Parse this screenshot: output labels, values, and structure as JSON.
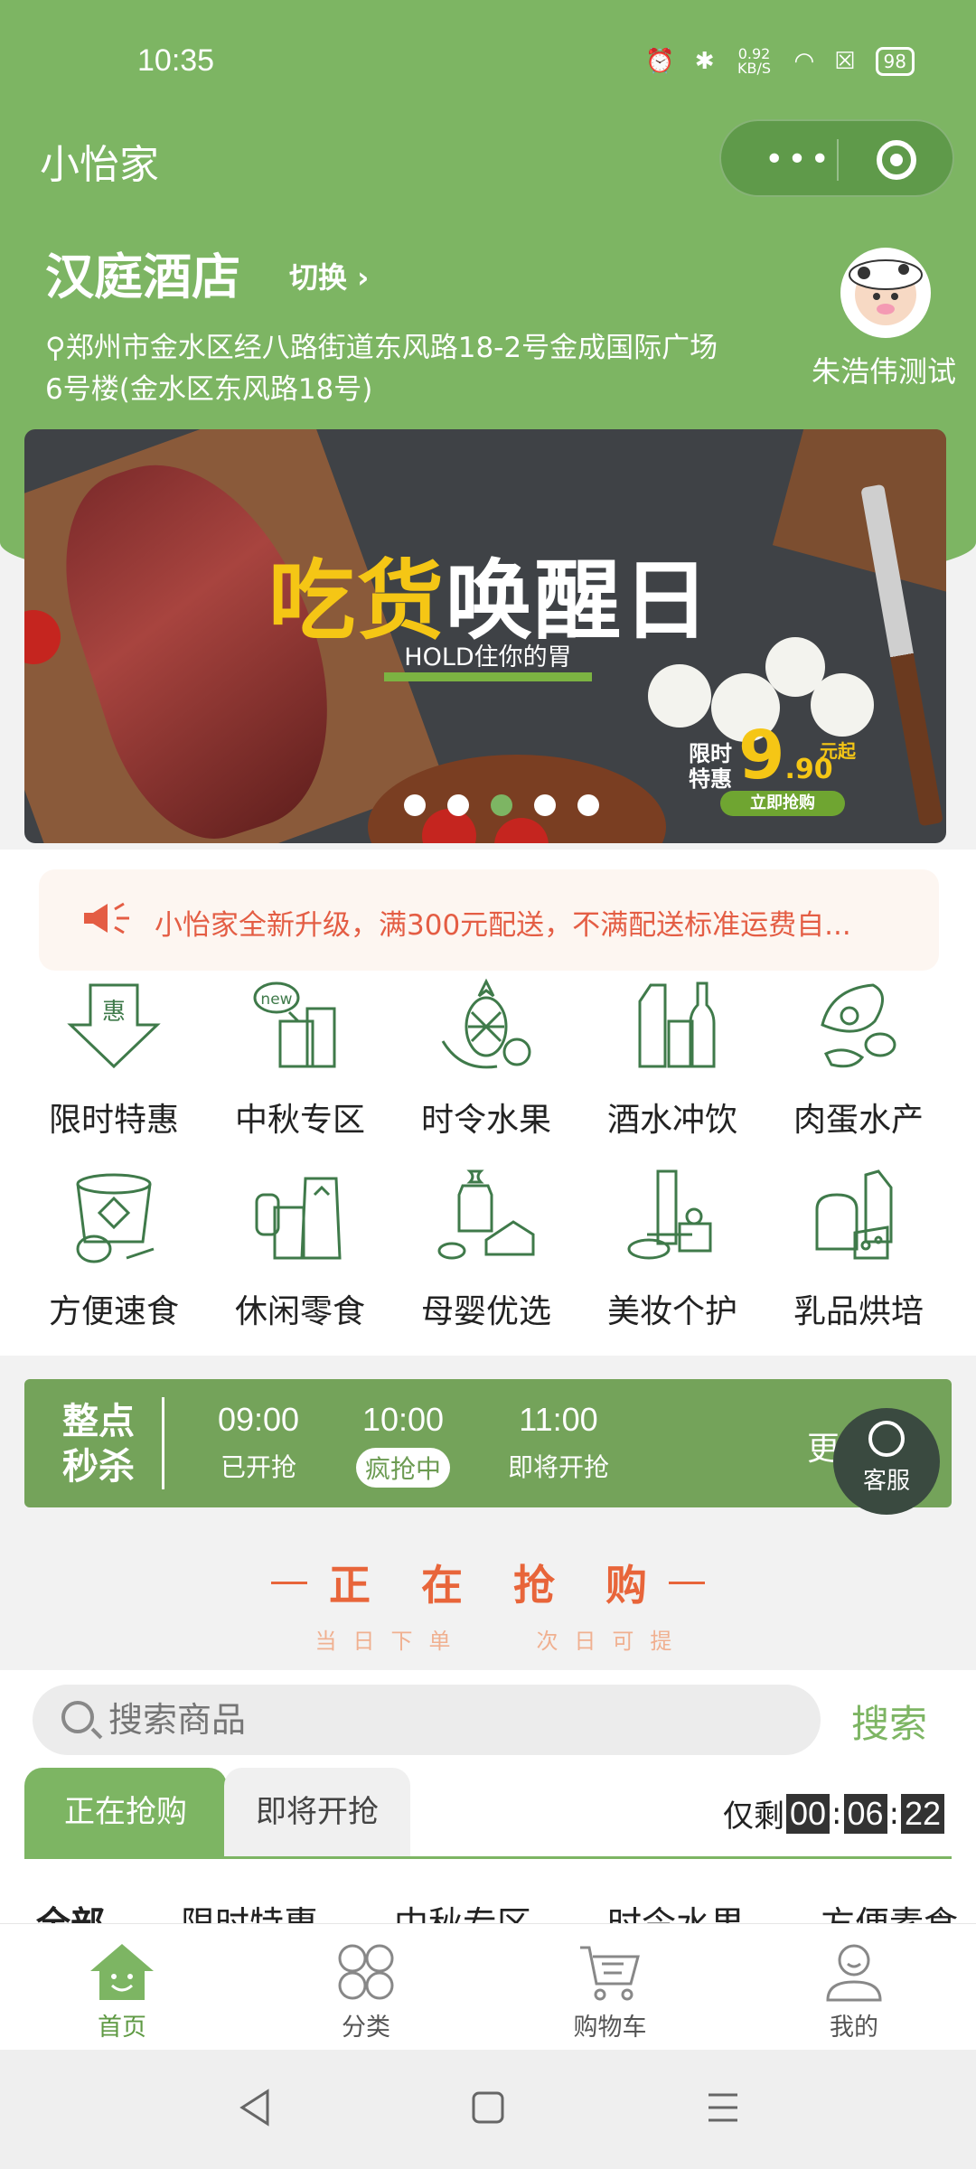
{
  "status_bar": {
    "time": "10:35",
    "net_speed": "0.92 KB/S",
    "battery": "98"
  },
  "app": {
    "title": "小怡家",
    "capsule_more": "•••"
  },
  "store": {
    "name": "汉庭酒店",
    "switch_label": "切换",
    "address": "郑州市金水区经八路街道东风路18-2号金成国际广场6号楼(金水区东风路18号)"
  },
  "user": {
    "name": "朱浩伟测试"
  },
  "banner": {
    "title_yellow": "吃货",
    "title_white": "唤醒日",
    "subtitle": "HOLD住你的胃",
    "promo_label": "限时特惠",
    "price": "9",
    "price_decimal": ".90",
    "price_unit": "元起",
    "cta": "立即抢购",
    "slides": 5,
    "active_slide": 3
  },
  "notice": {
    "text": "小怡家全新升级，满300元配送，不满配送标准运费自..."
  },
  "categories": [
    {
      "label": "限时特惠",
      "icon": "discount-tag-icon"
    },
    {
      "label": "中秋专区",
      "icon": "new-gift-icon"
    },
    {
      "label": "时令水果",
      "icon": "fruit-icon"
    },
    {
      "label": "酒水冲饮",
      "icon": "drink-bottles-icon"
    },
    {
      "label": "肉蛋水产",
      "icon": "meat-egg-icon"
    },
    {
      "label": "方便速食",
      "icon": "instant-noodle-icon"
    },
    {
      "label": "休闲零食",
      "icon": "snack-icon"
    },
    {
      "label": "母婴优选",
      "icon": "baby-bottle-icon"
    },
    {
      "label": "美妆个护",
      "icon": "cosmetics-icon"
    },
    {
      "label": "乳品烘培",
      "icon": "dairy-bread-icon"
    }
  ],
  "flash_sale": {
    "label_line1": "整点",
    "label_line2": "秒杀",
    "slots": [
      {
        "time": "09:00",
        "status": "已开抢"
      },
      {
        "time": "10:00",
        "status": "疯抢中"
      },
      {
        "time": "11:00",
        "status": "即将开抢"
      }
    ],
    "more": "更多",
    "service": "客服"
  },
  "section": {
    "title": "正在抢购",
    "subtitle_left": "当日下单",
    "subtitle_right": "次日可提"
  },
  "search": {
    "placeholder": "搜索商品",
    "button": "搜索"
  },
  "tabs": {
    "active": "正在抢购",
    "inactive": "即将开抢"
  },
  "countdown": {
    "label": "仅剩",
    "h": "00",
    "m": "06",
    "s": "22"
  },
  "sub_categories": [
    "全部",
    "限时特惠",
    "中秋专区",
    "时令水果",
    "方便素食"
  ],
  "bottom_nav": [
    {
      "label": "首页",
      "icon": "home-icon",
      "active": true
    },
    {
      "label": "分类",
      "icon": "category-icon",
      "active": false
    },
    {
      "label": "购物车",
      "icon": "cart-icon",
      "active": false
    },
    {
      "label": "我的",
      "icon": "profile-icon",
      "active": false
    }
  ],
  "colors": {
    "brand_green": "#7db563",
    "accent_orange": "#e8653a",
    "notice_red": "#e45d44"
  }
}
